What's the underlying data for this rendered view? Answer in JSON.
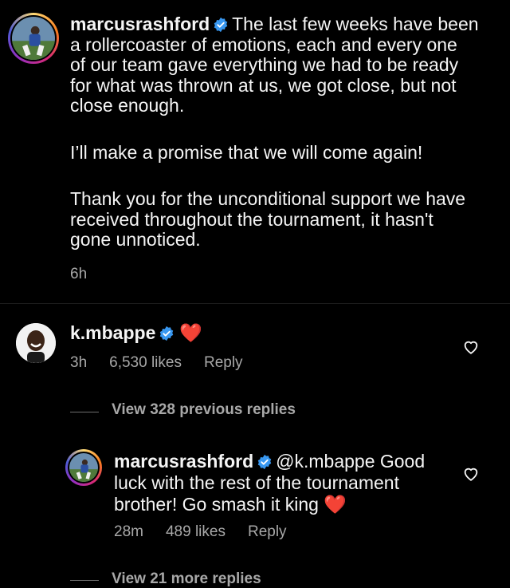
{
  "post": {
    "username": "marcusrashford",
    "paragraphs": [
      "The last few weeks have been",
      "a rollercoaster of emotions, each and every one",
      "of our team gave everything we had to be ready",
      "for what was thrown at us, we got close, but not",
      "close enough.",
      "I’ll make a promise that we will come again!",
      "Thank you for the unconditional support we have",
      "received throughout the tournament, it hasn't",
      "gone unnoticed."
    ],
    "time": "6h"
  },
  "comment": {
    "username": "k.mbappe",
    "emoji": "❤️",
    "time": "3h",
    "likes": "6,530 likes",
    "reply_label": "Reply"
  },
  "view_previous": "View 328 previous replies",
  "reply": {
    "username": "marcusrashford",
    "lines": [
      "@k.mbappe Good",
      "luck with the rest of the tournament",
      "brother! Go smash it king"
    ],
    "mention": "@k.mbappe",
    "time": "28m",
    "likes": "489 likes",
    "reply_label": "Reply"
  },
  "view_more": "View 21 more replies",
  "colors": {
    "background": "#000000",
    "text": "#f5f5f5",
    "secondary": "#a8a8a8",
    "verified": "#3897f0",
    "heart": "#ff3040"
  },
  "icons": [
    "verified-icon",
    "red-heart-emoji",
    "heart-outline-icon"
  ]
}
